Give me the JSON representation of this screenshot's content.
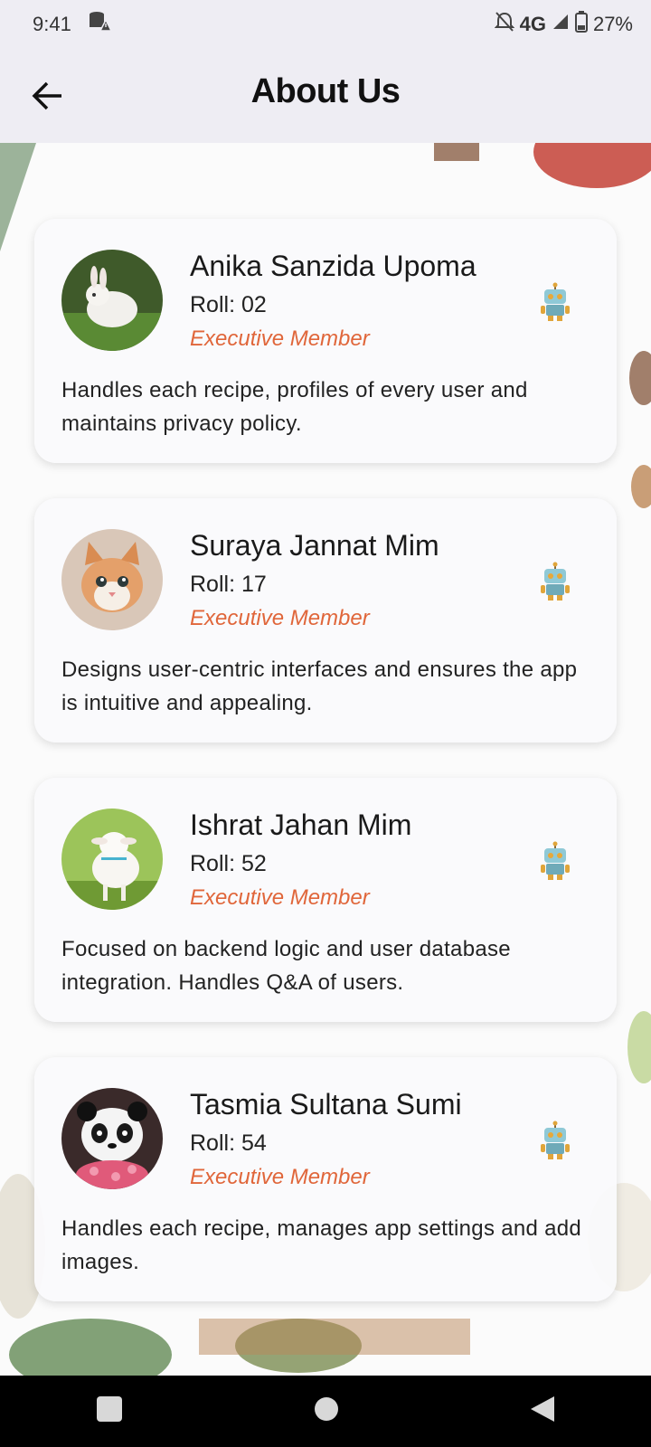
{
  "status_bar": {
    "time": "9:41",
    "network": "4G",
    "battery": "27%"
  },
  "header": {
    "title": "About Us"
  },
  "members": [
    {
      "name": "Anika Sanzida Upoma",
      "roll": "Roll: 02",
      "role": "Executive Member",
      "description": "Handles each recipe, profiles of every user and maintains privacy policy.",
      "avatar": "rabbit-avatar"
    },
    {
      "name": "Suraya Jannat Mim",
      "roll": "Roll: 17",
      "role": "Executive Member",
      "description": "Designs user-centric interfaces and ensures the app is intuitive and appealing.",
      "avatar": "kitten-avatar"
    },
    {
      "name": "Ishrat Jahan Mim",
      "roll": "Roll: 52",
      "role": "Executive Member",
      "description": "Focused on backend logic and user database integration. Handles Q&A of users.",
      "avatar": "lamb-avatar"
    },
    {
      "name": "Tasmia Sultana Sumi",
      "roll": "Roll: 54",
      "role": "Executive Member",
      "description": "Handles each recipe, manages app settings and add images.",
      "avatar": "panda-avatar"
    }
  ],
  "colors": {
    "accent": "#e0663a",
    "appbar": "#eeedf3"
  },
  "icons": [
    "back-arrow-icon",
    "robot-icon",
    "storage-alert-icon",
    "mute-icon",
    "signal-icon",
    "battery-icon",
    "recents-icon",
    "home-icon",
    "back-icon"
  ]
}
